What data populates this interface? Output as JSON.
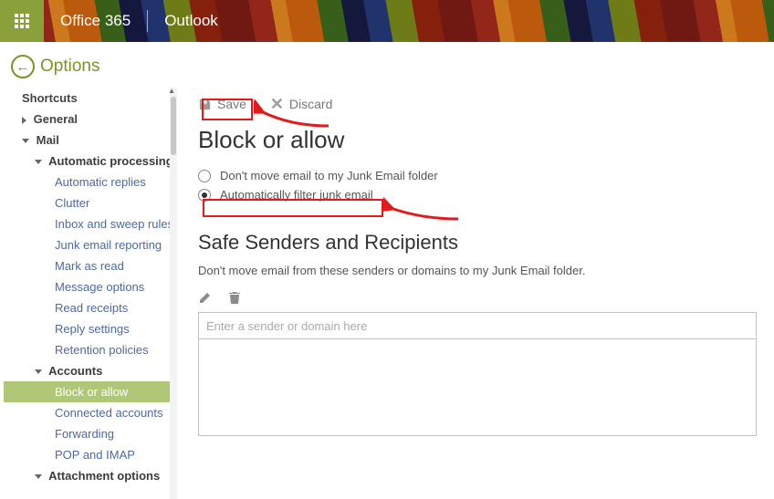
{
  "header": {
    "brand": "Office 365",
    "app": "Outlook"
  },
  "options_title": "Options",
  "sidebar": {
    "shortcuts": "Shortcuts",
    "general": "General",
    "mail": "Mail",
    "auto_processing": "Automatic processing",
    "auto_items": {
      "automatic_replies": "Automatic replies",
      "clutter": "Clutter",
      "inbox_sweep": "Inbox and sweep rules",
      "junk_reporting": "Junk email reporting",
      "mark_as_read": "Mark as read",
      "message_options": "Message options",
      "read_receipts": "Read receipts",
      "reply_settings": "Reply settings",
      "retention": "Retention policies"
    },
    "accounts": "Accounts",
    "account_items": {
      "block_or_allow": "Block or allow",
      "connected_accounts": "Connected accounts",
      "forwarding": "Forwarding",
      "pop_imap": "POP and IMAP"
    },
    "attachment": "Attachment options"
  },
  "toolbar": {
    "save": "Save",
    "discard": "Discard"
  },
  "page": {
    "title": "Block or allow",
    "radio_dont_move": "Don't move email to my Junk Email folder",
    "radio_auto_filter": "Automatically filter junk email",
    "safe_title": "Safe Senders and Recipients",
    "safe_desc": "Don't move email from these senders or domains to my Junk Email folder.",
    "sender_placeholder": "Enter a sender or domain here"
  }
}
